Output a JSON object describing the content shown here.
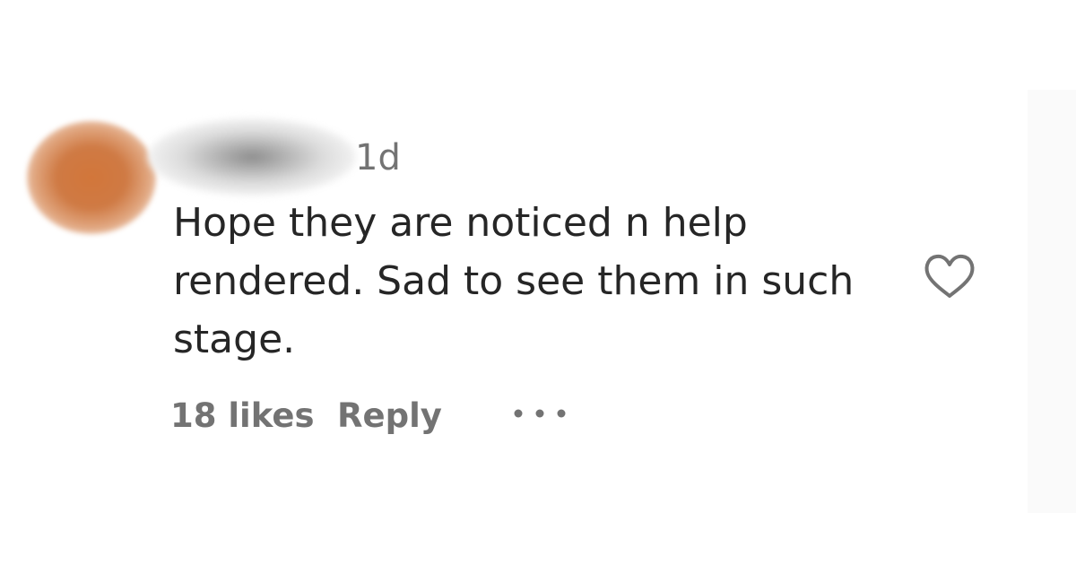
{
  "comment": {
    "timestamp": "1d",
    "text_lines": [
      "Hope they are noticed n help",
      "rendered. Sad to see them in such",
      "stage."
    ],
    "likes": "18 likes",
    "reply_label": "Reply"
  },
  "icons": {
    "like": "heart-outline-icon",
    "more": "more-options-icon"
  },
  "colors": {
    "text": "#262626",
    "secondary_text": "#737373",
    "avatar": "#d2763a",
    "background": "#ffffff"
  }
}
